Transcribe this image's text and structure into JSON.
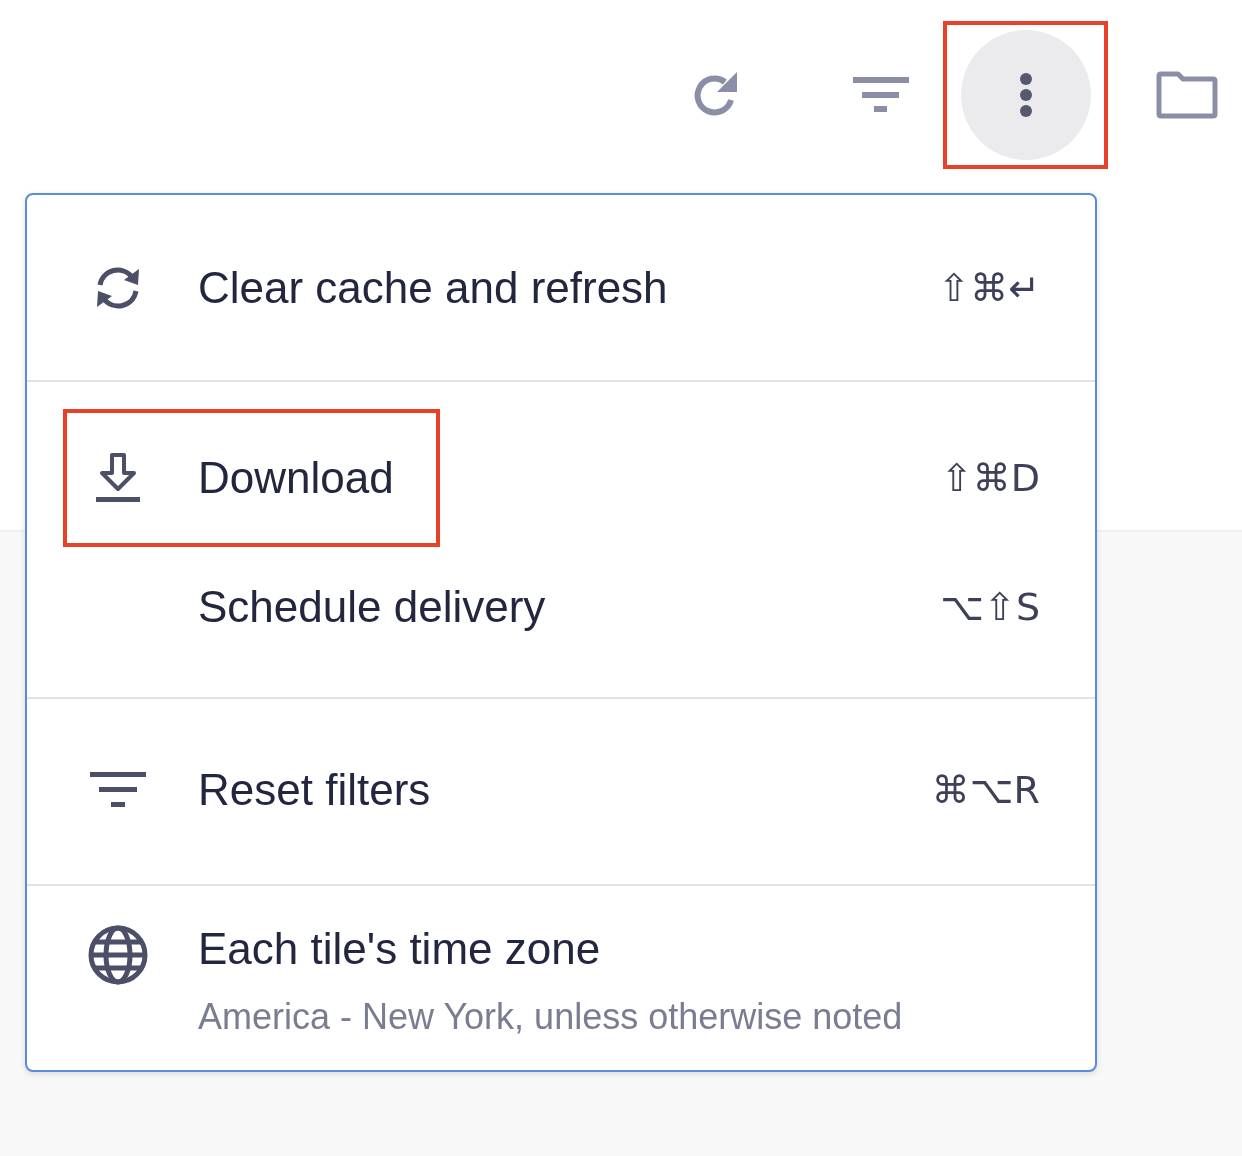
{
  "toolbar": {
    "buttons": [
      {
        "selected": false,
        "highlighted": false
      },
      {
        "selected": false,
        "highlighted": false
      },
      {
        "selected": true,
        "highlighted": true
      },
      {
        "selected": false,
        "highlighted": false
      }
    ]
  },
  "menu": {
    "sections": [
      {
        "items": [
          {
            "label": "Clear cache and refresh",
            "shortcut": "⇧⌘↵",
            "highlighted": false
          }
        ]
      },
      {
        "items": [
          {
            "label": "Download",
            "shortcut": "⇧⌘D",
            "highlighted": true
          },
          {
            "label": "Schedule delivery",
            "shortcut": "⌥⇧S",
            "highlighted": false
          }
        ]
      },
      {
        "items": [
          {
            "label": "Reset filters",
            "shortcut": "⌘⌥R",
            "highlighted": false
          }
        ]
      },
      {
        "items": [
          {
            "label": "Each tile's time zone",
            "detail": "America - New York, unless otherwise noted",
            "highlighted": false
          }
        ]
      }
    ]
  }
}
